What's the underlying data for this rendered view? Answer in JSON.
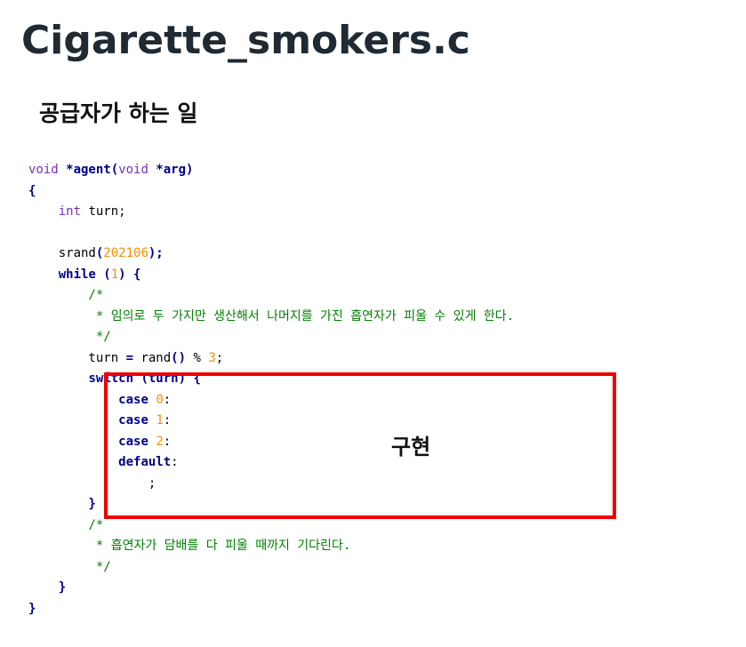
{
  "slide": {
    "title": "Cigarette_smokers.c",
    "subtitle": "공급자가 하는 일",
    "annotation_label": "구현"
  },
  "code": {
    "lines": [
      [
        {
          "t": "void",
          "c": "kw"
        },
        {
          "t": " *agent(",
          "c": "op"
        },
        {
          "t": "void",
          "c": "kw"
        },
        {
          "t": " *arg)",
          "c": "op"
        }
      ],
      [
        {
          "t": "{",
          "c": "op"
        }
      ],
      [
        {
          "t": "    "
        },
        {
          "t": "int",
          "c": "kw"
        },
        {
          "t": " turn;"
        }
      ],
      [],
      [
        {
          "t": "    srand"
        },
        {
          "t": "(",
          "c": "op"
        },
        {
          "t": "202106",
          "c": "num"
        },
        {
          "t": ");",
          "c": "op"
        }
      ],
      [
        {
          "t": "    "
        },
        {
          "t": "while",
          "c": "kwb"
        },
        {
          "t": " (",
          "c": "op"
        },
        {
          "t": "1",
          "c": "num"
        },
        {
          "t": ") {",
          "c": "op"
        }
      ],
      [
        {
          "t": "        /*",
          "c": "cm"
        }
      ],
      [
        {
          "t": "         * 임의로 두 가지만 생산해서 나머지를 가진 흡연자가 피울 수 있게 한다.",
          "c": "cm"
        }
      ],
      [
        {
          "t": "         */",
          "c": "cm"
        }
      ],
      [
        {
          "t": "        turn "
        },
        {
          "t": "=",
          "c": "op"
        },
        {
          "t": " rand"
        },
        {
          "t": "()",
          "c": "op"
        },
        {
          "t": " % "
        },
        {
          "t": "3",
          "c": "num"
        },
        {
          "t": ";"
        }
      ],
      [
        {
          "t": "        "
        },
        {
          "t": "switch",
          "c": "kwb"
        },
        {
          "t": " (turn) {",
          "c": "op"
        }
      ],
      [
        {
          "t": "            "
        },
        {
          "t": "case",
          "c": "kwb"
        },
        {
          "t": " "
        },
        {
          "t": "0",
          "c": "num"
        },
        {
          "t": ":"
        }
      ],
      [
        {
          "t": "            "
        },
        {
          "t": "case",
          "c": "kwb"
        },
        {
          "t": " "
        },
        {
          "t": "1",
          "c": "num"
        },
        {
          "t": ":"
        }
      ],
      [
        {
          "t": "            "
        },
        {
          "t": "case",
          "c": "kwb"
        },
        {
          "t": " "
        },
        {
          "t": "2",
          "c": "num"
        },
        {
          "t": ":"
        }
      ],
      [
        {
          "t": "            "
        },
        {
          "t": "default",
          "c": "kwb"
        },
        {
          "t": ":"
        }
      ],
      [
        {
          "t": "                ;"
        }
      ],
      [
        {
          "t": "        }",
          "c": "op"
        }
      ],
      [
        {
          "t": "        /*",
          "c": "cm"
        }
      ],
      [
        {
          "t": "         * 흡연자가 담배를 다 피울 때까지 기다린다.",
          "c": "cm"
        }
      ],
      [
        {
          "t": "         */",
          "c": "cm"
        }
      ],
      [
        {
          "t": "    }",
          "c": "op"
        }
      ],
      [
        {
          "t": "}",
          "c": "op"
        }
      ]
    ]
  },
  "colors": {
    "title": "#1f2a33",
    "keyword": "#7b2fbe",
    "control_keyword": "#00008b",
    "number": "#ff8c00",
    "comment": "#008000",
    "highlight_box": "#ee0000"
  }
}
